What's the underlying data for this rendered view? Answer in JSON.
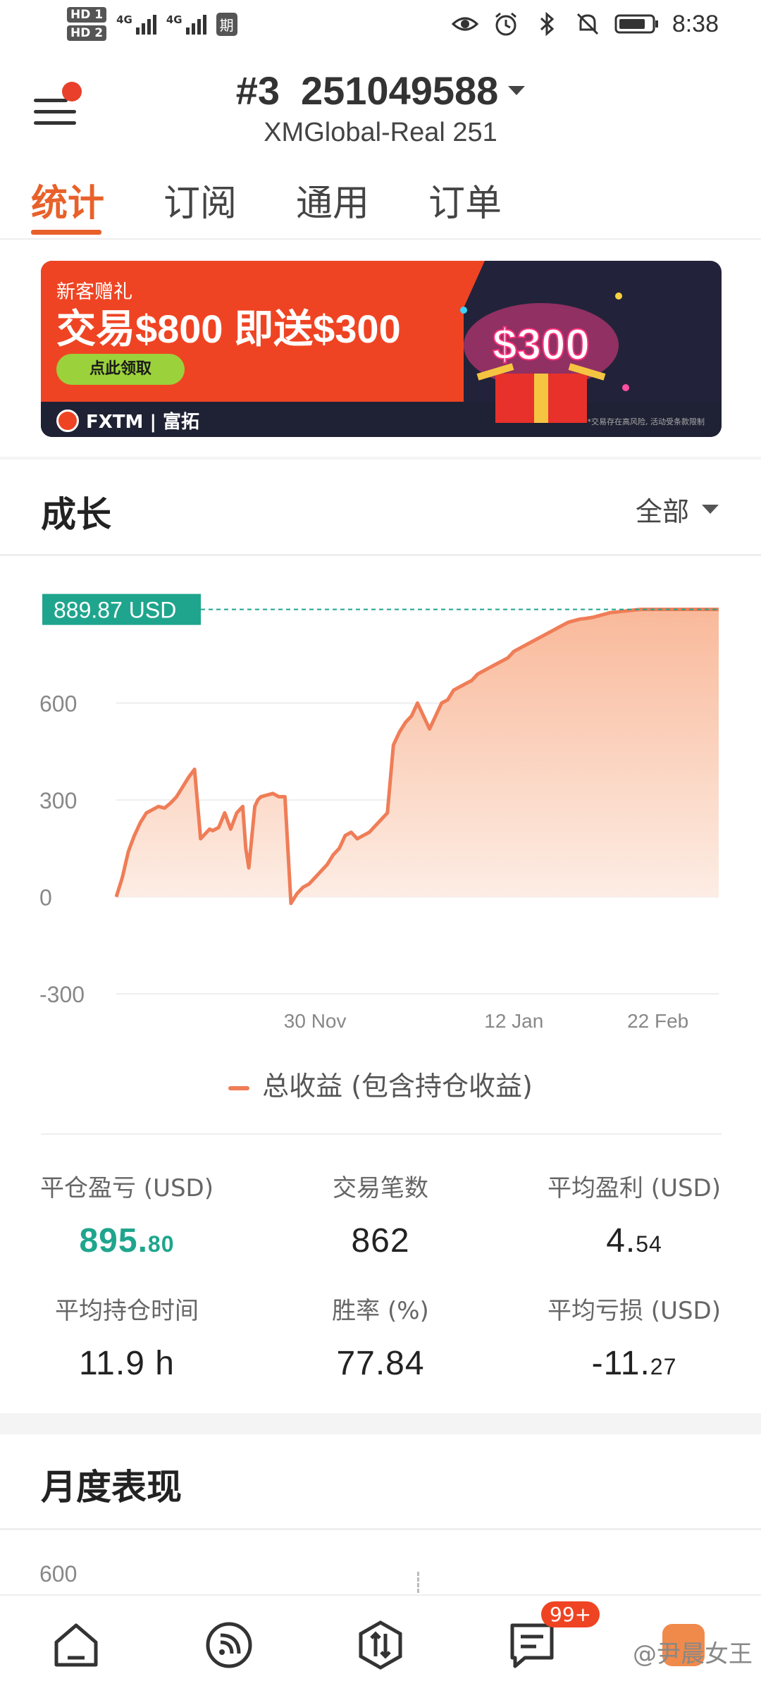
{
  "status_bar": {
    "hd1": "HD 1",
    "hd2": "HD 2",
    "net1": "4G",
    "net2": "4G",
    "qi": "期",
    "time": "8:38"
  },
  "header": {
    "account_number": "#3",
    "account_id": "251049588",
    "server": "XMGlobal-Real 251"
  },
  "tabs": [
    {
      "label": "统计",
      "active": true
    },
    {
      "label": "订阅",
      "active": false
    },
    {
      "label": "通用",
      "active": false
    },
    {
      "label": "订单",
      "active": false
    }
  ],
  "banner": {
    "title": "新客赠礼",
    "headline": "交易$800 即送$300",
    "cta": "点此领取",
    "brand": "FXTM | 富拓",
    "art_text": "$300",
    "disclaimer": "*交易存在高风险, 活动受条款限制"
  },
  "growth": {
    "title": "成长",
    "range": "全部",
    "current_label": "889.87 USD",
    "legend": "总收益 (包含持仓收益)"
  },
  "chart_data": {
    "type": "area",
    "ylim": [
      -300,
      900
    ],
    "yticks": [
      "600",
      "300",
      "0",
      "-300"
    ],
    "ytick_values": [
      600,
      300,
      0,
      -300
    ],
    "xticks": [
      "30 Nov",
      "12 Jan",
      "22 Feb"
    ],
    "xtick_positions": [
      0.33,
      0.66,
      0.95
    ],
    "current_value": 889.87,
    "series": [
      {
        "name": "总收益 (包含持仓收益)",
        "x": [
          0.0,
          0.01,
          0.02,
          0.03,
          0.04,
          0.05,
          0.06,
          0.07,
          0.08,
          0.09,
          0.1,
          0.11,
          0.12,
          0.13,
          0.14,
          0.15,
          0.155,
          0.16,
          0.17,
          0.18,
          0.19,
          0.2,
          0.21,
          0.215,
          0.22,
          0.23,
          0.235,
          0.24,
          0.25,
          0.26,
          0.27,
          0.28,
          0.29,
          0.3,
          0.31,
          0.32,
          0.33,
          0.34,
          0.35,
          0.36,
          0.37,
          0.38,
          0.39,
          0.4,
          0.41,
          0.42,
          0.43,
          0.44,
          0.45,
          0.46,
          0.47,
          0.48,
          0.49,
          0.5,
          0.51,
          0.52,
          0.53,
          0.54,
          0.55,
          0.56,
          0.57,
          0.58,
          0.59,
          0.6,
          0.61,
          0.62,
          0.63,
          0.64,
          0.65,
          0.66,
          0.67,
          0.68,
          0.69,
          0.7,
          0.71,
          0.72,
          0.73,
          0.74,
          0.75,
          0.76,
          0.77,
          0.78,
          0.79,
          0.8,
          0.81,
          0.82,
          0.83,
          0.84,
          0.85,
          0.86,
          0.87,
          0.88,
          0.89,
          0.9,
          0.91,
          0.92,
          0.93,
          0.94,
          0.95,
          0.96,
          0.97,
          0.98,
          0.99,
          1.0
        ],
        "values": [
          0,
          60,
          140,
          190,
          230,
          260,
          270,
          280,
          275,
          290,
          310,
          340,
          370,
          395,
          180,
          200,
          210,
          205,
          215,
          260,
          210,
          260,
          280,
          150,
          90,
          280,
          300,
          310,
          315,
          320,
          310,
          310,
          -20,
          10,
          30,
          40,
          60,
          80,
          100,
          130,
          150,
          190,
          200,
          180,
          190,
          200,
          220,
          240,
          260,
          470,
          510,
          540,
          560,
          600,
          560,
          520,
          560,
          600,
          610,
          640,
          650,
          660,
          670,
          690,
          700,
          710,
          720,
          730,
          740,
          760,
          770,
          780,
          790,
          800,
          810,
          820,
          830,
          840,
          850,
          855,
          860,
          862,
          865,
          870,
          875,
          880,
          882,
          884,
          886,
          888,
          889.87,
          889.87,
          889.87,
          889.87,
          889.87,
          889.87,
          889.87,
          889.87,
          889.87,
          889.87,
          889.87,
          889.87,
          889.87,
          889.87
        ]
      }
    ]
  },
  "stats": [
    {
      "label": "平仓盈亏 (USD)",
      "int": "895.",
      "dec": "80",
      "color": "green"
    },
    {
      "label": "交易笔数",
      "int": "862",
      "dec": "",
      "color": "default"
    },
    {
      "label": "平均盈利 (USD)",
      "int": "4.",
      "dec": "54",
      "color": "default"
    },
    {
      "label": "平均持仓时间",
      "int": "11.9 h",
      "dec": "",
      "color": "default"
    },
    {
      "label": "胜率 (%)",
      "int": "77.84",
      "dec": "",
      "color": "default"
    },
    {
      "label": "平均亏损 (USD)",
      "int": "-11.",
      "dec": "27",
      "color": "default"
    }
  ],
  "monthly": {
    "title": "月度表现",
    "ytick": "600"
  },
  "bottom_nav": {
    "badge": "99+",
    "watermark": "@尹晨女王",
    "items": [
      "home-icon",
      "feed-icon",
      "trade-icon",
      "messages-icon",
      "profile-icon"
    ]
  },
  "colors": {
    "accent": "#e8612a",
    "green": "#1fa58d",
    "line": "#ef7d57",
    "area_top": "#f9b99a",
    "area_bottom": "#fdeee6"
  }
}
